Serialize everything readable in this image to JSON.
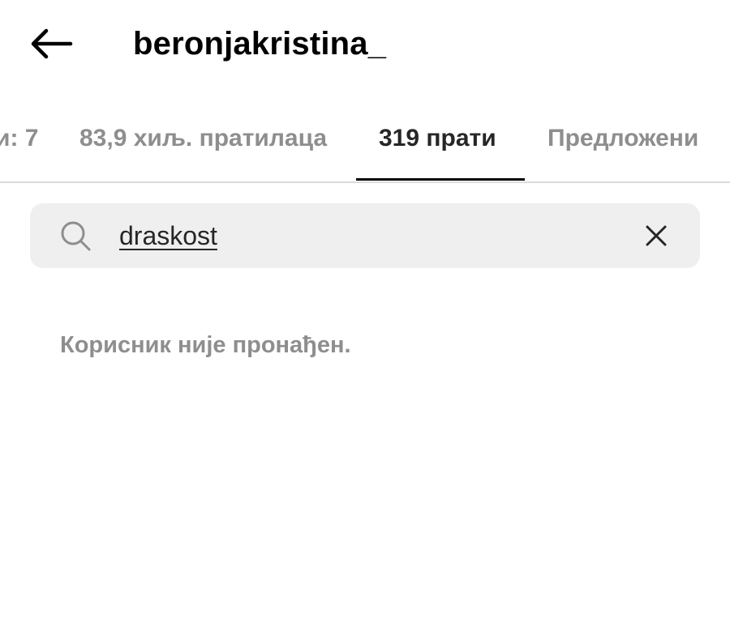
{
  "header": {
    "back_icon": "arrow-left-icon",
    "title": "beronjakristina_"
  },
  "tabs": [
    {
      "label": "и: 7"
    },
    {
      "label": "83,9 хиљ. пратилаца"
    },
    {
      "label": "319 прати",
      "active": true
    },
    {
      "label": "Предложени"
    }
  ],
  "search": {
    "icon": "search-icon",
    "value": "draskost",
    "clear_icon": "close-icon"
  },
  "results": {
    "empty_message": "Корисник није пронађен."
  },
  "colors": {
    "primary_text": "#262626",
    "secondary_text": "#8e8e8e",
    "search_bg": "#efefef",
    "divider": "#dbdbdb",
    "active_indicator": "#000000"
  }
}
